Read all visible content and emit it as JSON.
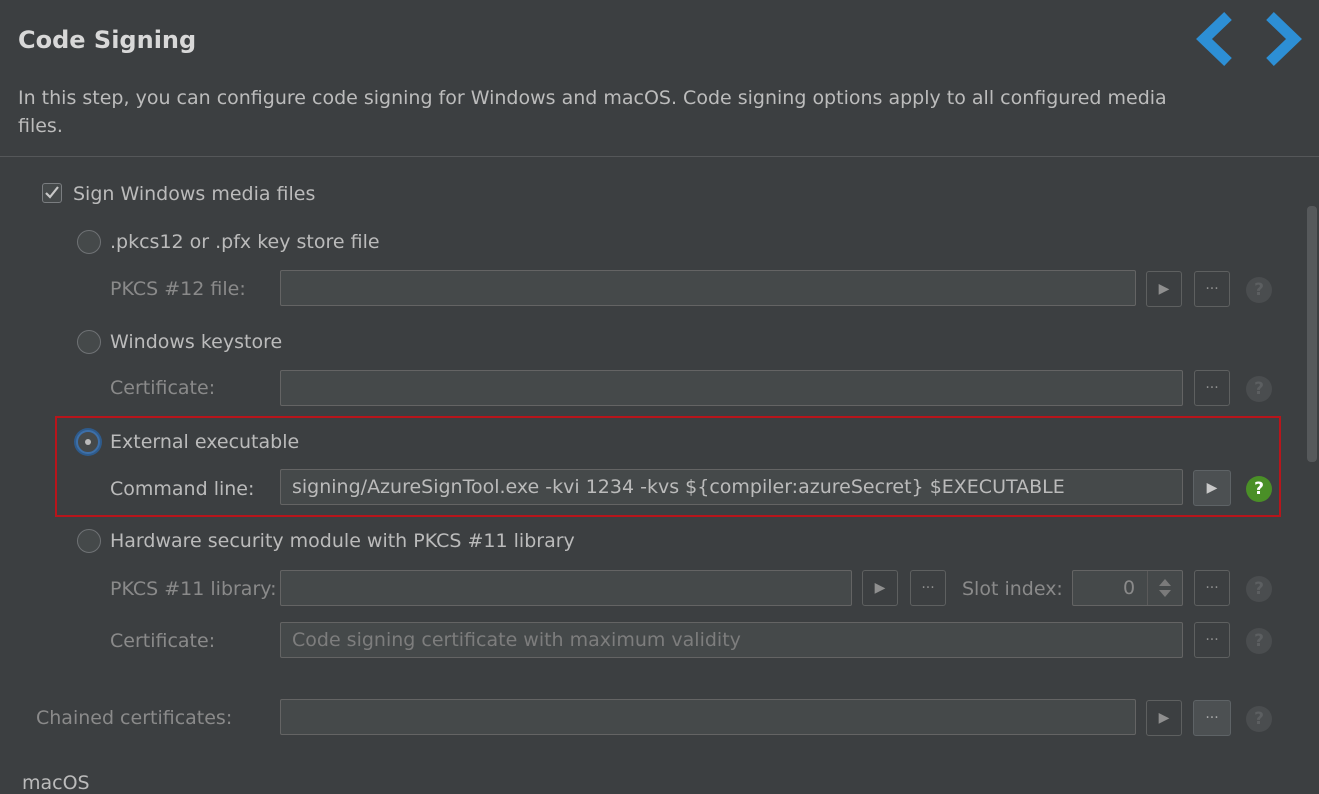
{
  "header": {
    "title": "Code Signing",
    "description": "In this step, you can configure code signing for Windows and macOS. Code signing options apply to all configured media files."
  },
  "windows": {
    "sign_label": "Sign Windows media files",
    "sign_checked": true,
    "pkcs12": {
      "option_label": ".pkcs12 or .pfx key store file",
      "file_label": "PKCS #12 file:",
      "file_value": ""
    },
    "keystore": {
      "option_label": "Windows keystore",
      "cert_label": "Certificate:",
      "cert_value": ""
    },
    "external": {
      "option_label": "External executable",
      "cmd_label": "Command line:",
      "cmd_value": "signing/AzureSignTool.exe -kvi 1234 -kvs ${compiler:azureSecret} $EXECUTABLE",
      "selected": true
    },
    "hsm": {
      "option_label": "Hardware security module with PKCS #11 library",
      "lib_label": "PKCS #11 library:",
      "lib_value": "",
      "slot_label": "Slot index:",
      "slot_value": "0",
      "cert_label": "Certificate:",
      "cert_placeholder": "Code signing certificate with maximum validity"
    }
  },
  "chained": {
    "label": "Chained certificates:",
    "value": ""
  },
  "macos": {
    "section_label": "macOS"
  },
  "glyphs": {
    "ellipsis": "···",
    "play": "▶",
    "help": "?"
  },
  "colors": {
    "accent_blue": "#2d8fd5",
    "highlight_red": "#b8151b",
    "help_green": "#4a8f27"
  }
}
